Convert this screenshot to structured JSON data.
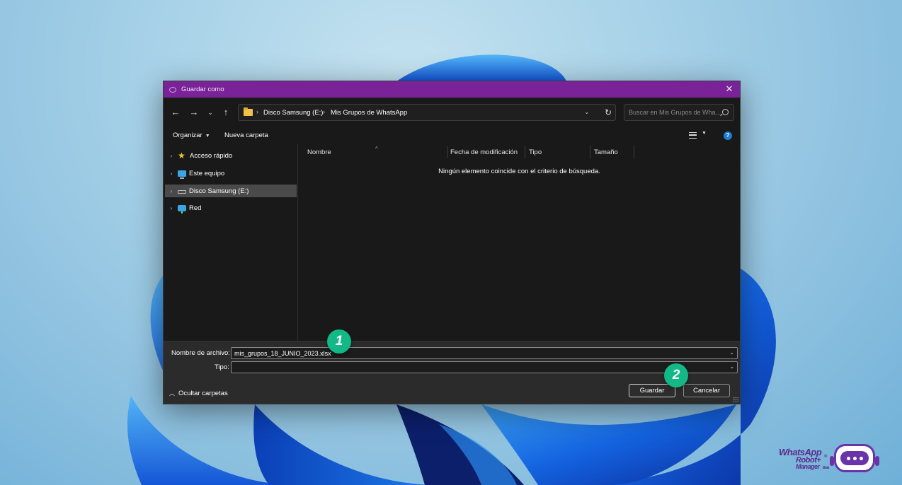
{
  "dialog": {
    "title": "Guardar como",
    "breadcrumb": [
      "Disco Samsung (E:)",
      "Mis Grupos de WhatsApp"
    ],
    "search_placeholder": "Buscar en Mis Grupos de Wha...",
    "toolbar": {
      "organize": "Organizar",
      "new_folder": "Nueva carpeta"
    },
    "sidebar": [
      {
        "label": "Acceso rápido",
        "icon": "star-icon",
        "selected": false
      },
      {
        "label": "Este equipo",
        "icon": "computer-icon",
        "selected": false
      },
      {
        "label": "Disco Samsung (E:)",
        "icon": "drive-icon",
        "selected": true
      },
      {
        "label": "Red",
        "icon": "network-icon",
        "selected": false
      }
    ],
    "columns": [
      "Nombre",
      "Fecha de modificación",
      "Tipo",
      "Tamaño"
    ],
    "empty_message": "Ningún elemento coincide con el criterio de búsqueda.",
    "filename_label": "Nombre de archivo:",
    "filename_value": "mis_grupos_18_JUNIO_2023.xlsx",
    "type_label": "Tipo:",
    "type_value": "",
    "hide_folders": "Ocultar carpetas",
    "save_button": "Guardar",
    "cancel_button": "Cancelar"
  },
  "badges": [
    "1",
    "2"
  ],
  "logo": {
    "line1": "WhatsApp",
    "line2": "Robot+",
    "registered": "®",
    "line3": "Manager",
    "beta": "Beta"
  },
  "colors": {
    "titlebar": "#7a2399",
    "badge": "#12b886",
    "logo": "#5a2c8c"
  }
}
